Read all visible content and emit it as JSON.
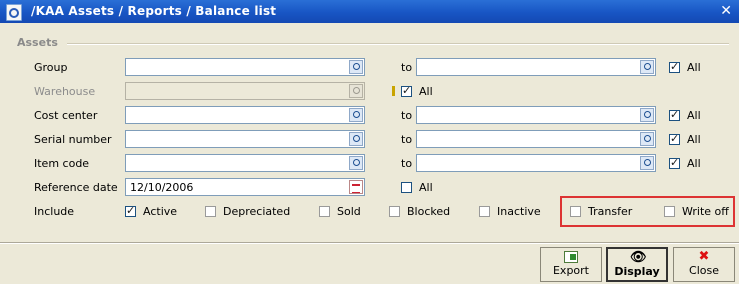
{
  "window": {
    "title": "/KAA  Assets / Reports / Balance list",
    "close_glyph": "✕"
  },
  "group": {
    "label": "Assets"
  },
  "form": {
    "to_label": "to",
    "all_label": "All",
    "rows": {
      "group": {
        "label": "Group",
        "from": "",
        "to": "",
        "all": true
      },
      "warehouse": {
        "label": "Warehouse",
        "from": "",
        "all": true
      },
      "cost_center": {
        "label": "Cost center",
        "from": "",
        "to": "",
        "all": true
      },
      "serial_number": {
        "label": "Serial number",
        "from": "",
        "to": "",
        "all": true
      },
      "item_code": {
        "label": "Item code",
        "from": "",
        "to": "",
        "all": true
      },
      "reference_date": {
        "label": "Reference date",
        "value": "12/10/2006",
        "all": false
      }
    },
    "include": {
      "label": "Include",
      "options": {
        "active": {
          "label": "Active",
          "checked": true
        },
        "depreciated": {
          "label": "Depreciated",
          "checked": false
        },
        "sold": {
          "label": "Sold",
          "checked": false
        },
        "blocked": {
          "label": "Blocked",
          "checked": false
        },
        "inactive": {
          "label": "Inactive",
          "checked": false
        },
        "transfer": {
          "label": "Transfer",
          "checked": false
        },
        "write_off": {
          "label": "Write off",
          "checked": false
        }
      }
    }
  },
  "buttons": {
    "export": "Export",
    "display": "Display",
    "close": "Close"
  },
  "colors": {
    "titlebar": "#1855c4",
    "window_bg": "#ece9d8",
    "highlight_box": "#dd3333"
  }
}
